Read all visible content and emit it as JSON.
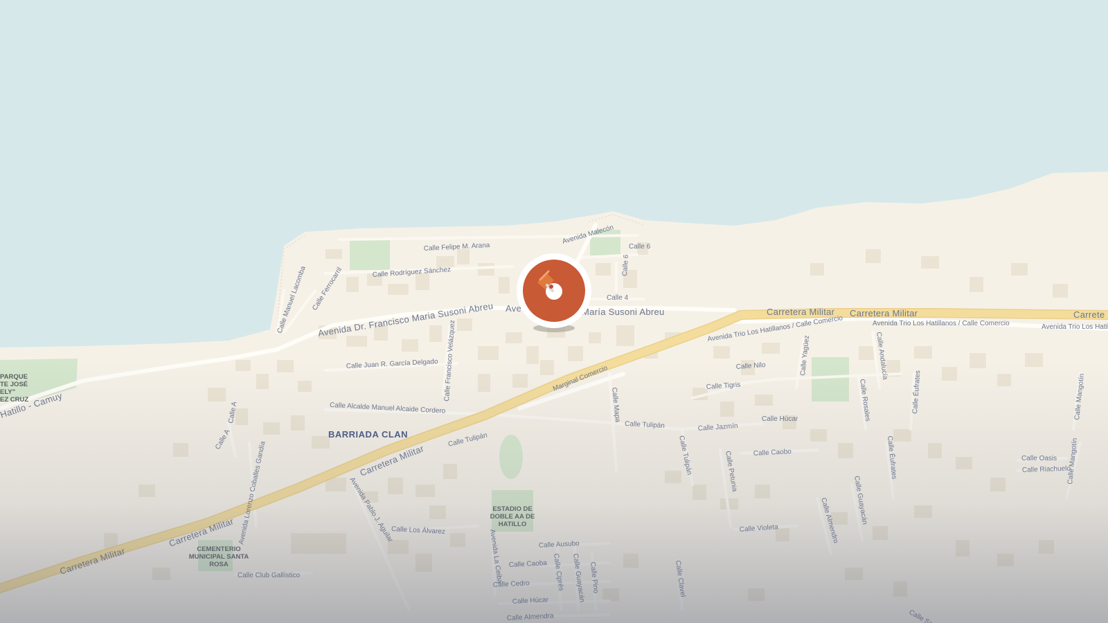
{
  "map": {
    "roads": {
      "carretera_militar": "Carretera Militar",
      "avenida_susoni": "Avenida Dr. Francisco Maria Susoni Abreu",
      "avenida_susoni_partial_left": "Ave",
      "avenida_susoni_partial_right": "María Susoni Abreu",
      "avenida_trio": "Avenida Trio Los Hatillanos / Calle Comercio",
      "avenida_trio_short": "Avenida Trio Los Hatillanos / Calle Comercio",
      "avenida_trio_right": "Avenida Trio Los Hatil",
      "carretera_militar_edge": "Carrete",
      "marginal_comercio": "Marginal Comercio",
      "avenida_malecon": "Avenida Malecón",
      "hatillo_camuy": "Hatillo - Camuy",
      "avenida_pablo": "Avenida Pablo J. Aguilar",
      "avenida_la_ceiba": "Avenida La Ceiba",
      "avenida_lorenzo": "Avenida Lorenzo Coballes Gandía",
      "calle_felipe": "Calle Felipe M. Arana",
      "calle_rodriguez": "Calle Rodríguez Sánchez",
      "calle_manuel": "Calle Manuel Lacomba",
      "calle_ferrocarril": "Calle Ferrocarril",
      "calle_juan": "Calle Juan R. García Delgado",
      "calle_francisco": "Calle Francisco Velázquez",
      "calle_alcalde": "Calle Alcalde Manuel Alcaide Cordero",
      "calle_6_top": "Calle 6",
      "calle_6_vertical": "Calle 6",
      "calle_4": "Calle 4",
      "calle_a": "Calle A",
      "calle_a4": "Calle A",
      "calle_tulipan_left": "Calle Tulipán",
      "calle_tulipan_mid": "Calle Tulipán",
      "calle_tulipan_vertical": "Calle Tulipán",
      "calle_jazmin": "Calle Jazmín",
      "calle_hucar": "Calle Húcar",
      "calle_nilo": "Calle Nilo",
      "calle_tigris": "Calle Tigris",
      "calle_mapa": "Calle Mapa",
      "calle_yaguez": "Calle Yagüez",
      "calle_andalucia": "Calle Andalucía",
      "calle_rosales": "Calle Rosales",
      "calle_eufrates_a": "Calle Éufrates",
      "calle_eufrates_b": "Calle Éufrates",
      "calle_mangotin_a": "Calle Mangotín",
      "calle_mangotin_b": "Calle Mangotín",
      "calle_caobo": "Calle Caobo",
      "calle_petunia": "Calle Petunia",
      "calle_violeta": "Calle Violeta",
      "calle_almendro": "Calle Almendro",
      "calle_guayacan_a": "Calle Guayacán",
      "calle_guayacan_b": "Calle Guayacán",
      "calle_oasis": "Calle Oasis",
      "calle_riachuelo": "Calle Riachuelo",
      "calle_los_alvarez": "Calle Los Álvarez",
      "calle_ausubo": "Calle Ausubo",
      "calle_caoba": "Calle Caoba",
      "calle_cedro": "Calle Cedro",
      "calle_hucar_bottom": "Calle Húcar",
      "calle_almendra": "Calle Almendra",
      "calle_cipres": "Calle Ciprés",
      "calle_pino": "Calle Pino",
      "calle_clavel": "Calle Clavel",
      "calle_club": "Calle Club Gallístico",
      "calle_santo": "Calle Sant"
    },
    "areas": {
      "barriada_clan": "BARRIADA CLAN"
    },
    "pois": {
      "parque_lines": [
        "PARQUE",
        "TE JOSÉ",
        "ELY\"",
        "EZ CRUZ"
      ],
      "estadio_lines": [
        "ESTADIO DE",
        "DOBLE AA DE",
        "HATILLO"
      ],
      "cementerio_lines": [
        "CEMENTERIO",
        "MUNICIPAL SANTA",
        "ROSA"
      ]
    },
    "marker": {
      "color": "#c85a35",
      "icon": "pin-icon"
    },
    "colors": {
      "water": "#d6e8ea",
      "land": "#f6f1e7",
      "highway": "#f4dd9c",
      "park": "#d4e6cc"
    }
  }
}
